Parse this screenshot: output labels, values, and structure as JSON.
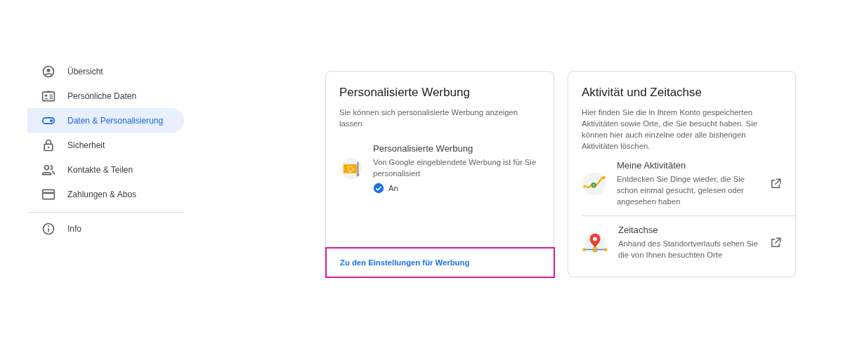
{
  "sidebar": {
    "items": [
      {
        "label": "Übersicht",
        "selected": false
      },
      {
        "label": "Persönliche Daten",
        "selected": false
      },
      {
        "label": "Daten & Personalisierung",
        "selected": true
      },
      {
        "label": "Sicherheit",
        "selected": false
      },
      {
        "label": "Kontakte & Teilen",
        "selected": false
      },
      {
        "label": "Zahlungen & Abos",
        "selected": false
      }
    ],
    "footer_items": [
      {
        "label": "Info",
        "selected": false
      }
    ]
  },
  "ads_card": {
    "title": "Personalisierte Werbung",
    "description": "Sie können sich personalisierte Werbung anzeigen lassen",
    "setting": {
      "title": "Personalisierte Werbung",
      "description": "Von Google eingeblendete Werbung ist für Sie personalisiert",
      "checked": true,
      "status": "An"
    },
    "link": {
      "label": "Zu den Einstellungen für Werbung",
      "highlighted": true
    }
  },
  "activity_card": {
    "title": "Aktivität und Zeitachse",
    "description": "Hier finden Sie die in Ihrem Konto gespeicherten Aktivitäten sowie Orte, die Sie besucht haben. Sie können hier auch einzelne oder alle bisherigen Aktivitäten löschen.",
    "entries": [
      {
        "title": "Meine Aktivitäten",
        "description": "Entdecken Sie Dinge wieder, die Sie schon einmal gesucht, gelesen oder angesehen haben"
      },
      {
        "title": "Zeitachse",
        "description": "Anhand des Standortverlaufs sehen Sie die von Ihnen besuchten Orte"
      }
    ]
  }
}
